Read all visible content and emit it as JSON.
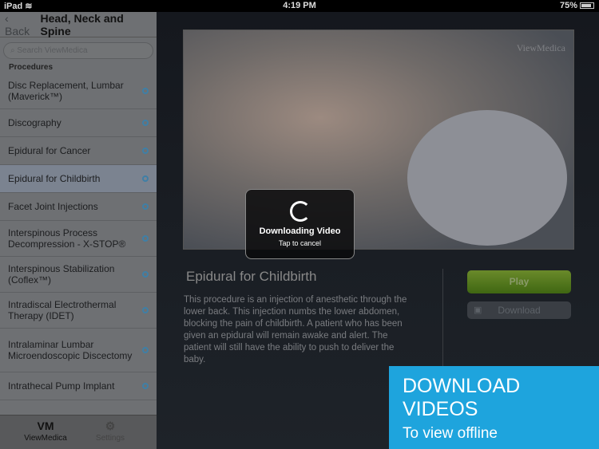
{
  "status": {
    "device": "iPad",
    "time": "4:19 PM",
    "battery": "75%",
    "battery_level": 0.75
  },
  "sidebar": {
    "back_label": "Back",
    "title": "Head, Neck and Spine",
    "search_placeholder": "Search ViewMedica",
    "section": "Procedures",
    "items": [
      {
        "label": "Disc Replacement, Lumbar (Maverick™)"
      },
      {
        "label": "Discography"
      },
      {
        "label": "Epidural for Cancer"
      },
      {
        "label": "Epidural for Childbirth",
        "selected": true
      },
      {
        "label": "Facet Joint Injections"
      },
      {
        "label": "Interspinous Process Decompression - X-STOP®"
      },
      {
        "label": "Interspinous Stabilization (Coflex™)"
      },
      {
        "label": "Intradiscal Electrothermal Therapy (IDET)"
      },
      {
        "label": "Intralaminar Lumbar Microendoscopic Discectomy"
      },
      {
        "label": "Intrathecal Pump Implant"
      }
    ],
    "tabs": [
      {
        "icon": "VM",
        "label": "ViewMedica"
      },
      {
        "icon": "gear-icon",
        "label": "Settings"
      }
    ]
  },
  "main": {
    "watermark": "ViewMedica",
    "overlay": {
      "title": "Downloading Video",
      "subtitle": "Tap to cancel"
    },
    "title": "Epidural for Childbirth",
    "description": "This procedure is an injection of anesthetic through the lower back. This injection numbs the lower abdomen, blocking the pain of childbirth. A patient who has been given an epidural will remain awake and alert. The patient will still have the ability to push to deliver the baby.",
    "play_label": "Play",
    "download_label": "Download"
  },
  "promo": {
    "headline": "DOWNLOAD VIDEOS",
    "subline": "To view offline",
    "color": "#1ea4dd"
  }
}
